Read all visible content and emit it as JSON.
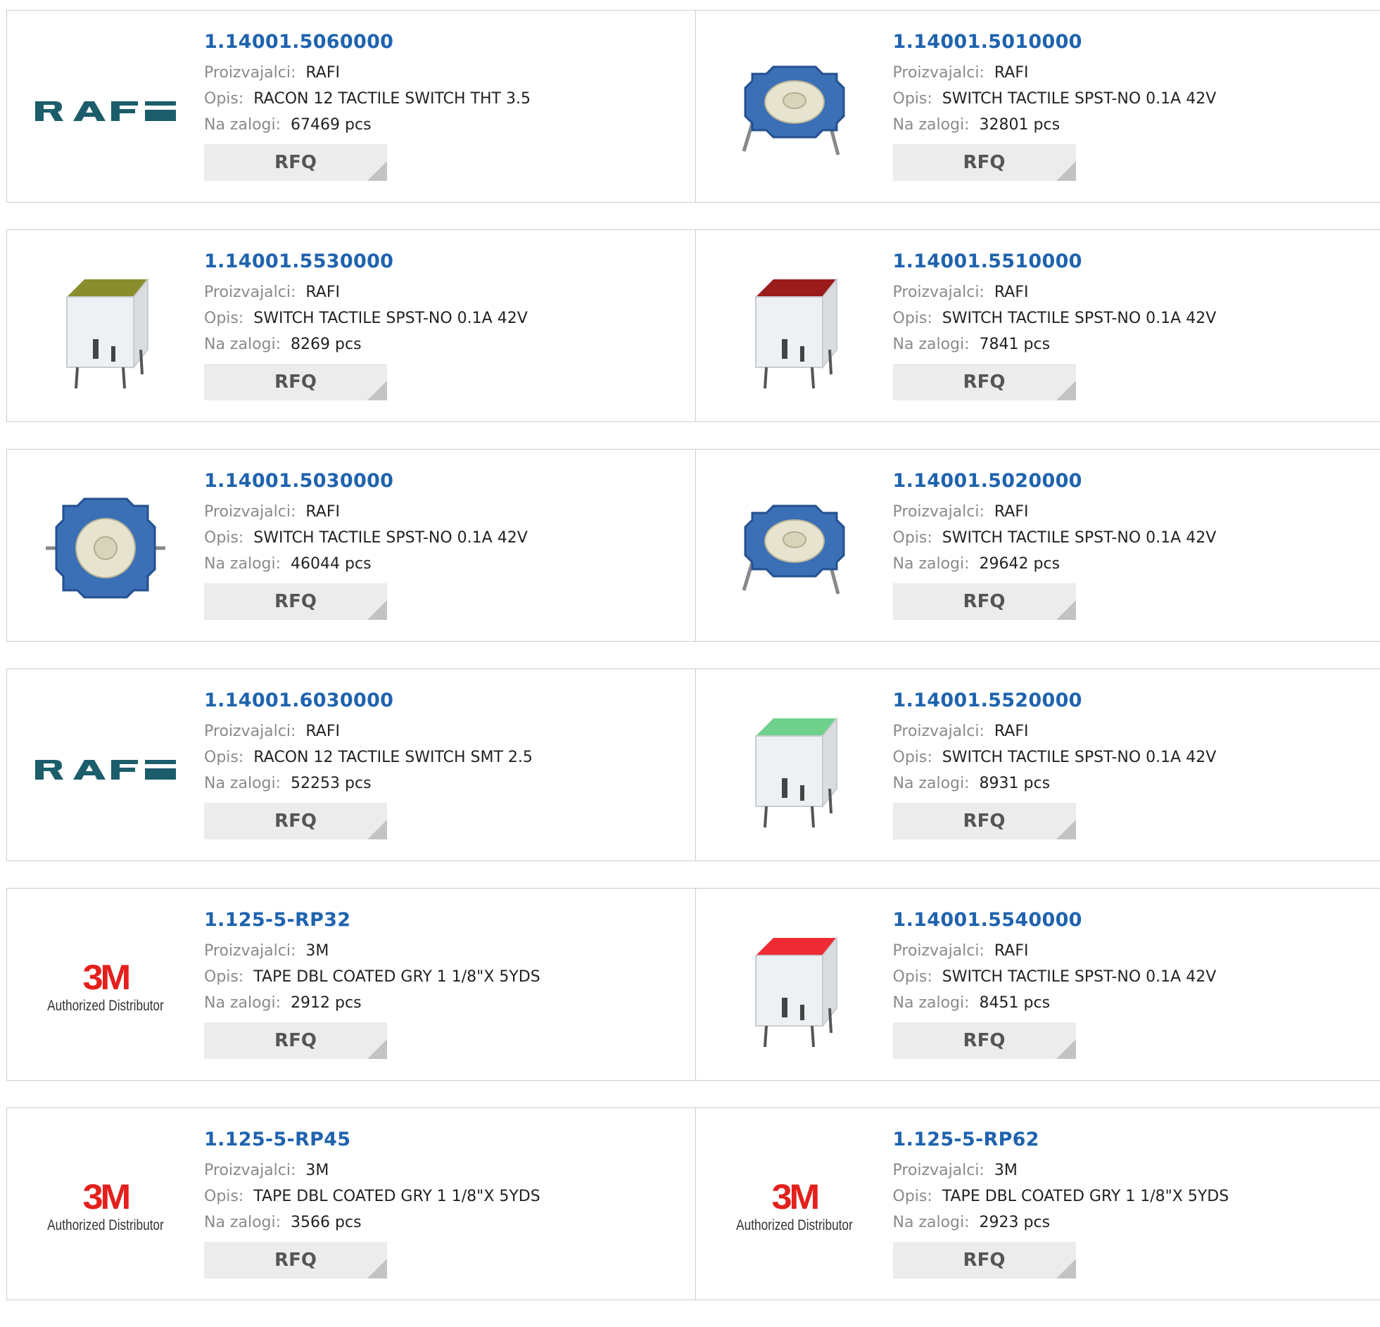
{
  "labels": {
    "manufacturer": "Proizvajalci:",
    "description": "Opis:",
    "stock": "Na zalogi:",
    "rfq": "RFQ"
  },
  "colors": {
    "part_link": "#1f63ae",
    "rafi_logo": "#1b5d6b",
    "logo_3m": "#e4201c"
  },
  "products": [
    {
      "part": "1.14001.5060000",
      "manufacturer": "RAFI",
      "description": "RACON 12 TACTILE SWITCH THT 3.5",
      "stock": "67469 pcs",
      "image": "rafi-logo"
    },
    {
      "part": "1.14001.5010000",
      "manufacturer": "RAFI",
      "description": "SWITCH TACTILE SPST-NO 0.1A 42V",
      "stock": "32801 pcs",
      "image": "blue-tactile-switch-side"
    },
    {
      "part": "1.14001.5530000",
      "manufacturer": "RAFI",
      "description": "SWITCH TACTILE SPST-NO 0.1A 42V",
      "stock": "8269 pcs",
      "image": "white-switch-olive-cap"
    },
    {
      "part": "1.14001.5510000",
      "manufacturer": "RAFI",
      "description": "SWITCH TACTILE SPST-NO 0.1A 42V",
      "stock": "7841 pcs",
      "image": "white-switch-red-cap"
    },
    {
      "part": "1.14001.5030000",
      "manufacturer": "RAFI",
      "description": "SWITCH TACTILE SPST-NO 0.1A 42V",
      "stock": "46044 pcs",
      "image": "blue-tactile-switch-top"
    },
    {
      "part": "1.14001.5020000",
      "manufacturer": "RAFI",
      "description": "SWITCH TACTILE SPST-NO 0.1A 42V",
      "stock": "29642 pcs",
      "image": "blue-tactile-switch-side"
    },
    {
      "part": "1.14001.6030000",
      "manufacturer": "RAFI",
      "description": "RACON 12 TACTILE SWITCH SMT 2.5",
      "stock": "52253 pcs",
      "image": "rafi-logo"
    },
    {
      "part": "1.14001.5520000",
      "manufacturer": "RAFI",
      "description": "SWITCH TACTILE SPST-NO 0.1A 42V",
      "stock": "8931 pcs",
      "image": "white-switch-green-cap"
    },
    {
      "part": "1.125-5-RP32",
      "manufacturer": "3M",
      "description": "TAPE DBL COATED GRY 1 1/8\"X 5YDS",
      "stock": "2912 pcs",
      "image": "3m-logo"
    },
    {
      "part": "1.14001.5540000",
      "manufacturer": "RAFI",
      "description": "SWITCH TACTILE SPST-NO 0.1A 42V",
      "stock": "8451 pcs",
      "image": "white-switch-bright-red-cap"
    },
    {
      "part": "1.125-5-RP45",
      "manufacturer": "3M",
      "description": "TAPE DBL COATED GRY 1 1/8\"X 5YDS",
      "stock": "3566 pcs",
      "image": "3m-logo"
    },
    {
      "part": "1.125-5-RP62",
      "manufacturer": "3M",
      "description": "TAPE DBL COATED GRY 1 1/8\"X 5YDS",
      "stock": "2923 pcs",
      "image": "3m-logo"
    }
  ],
  "logos": {
    "rafi": "RAFI",
    "threem_mark": "3M",
    "threem_text": "Authorized Distributor"
  }
}
